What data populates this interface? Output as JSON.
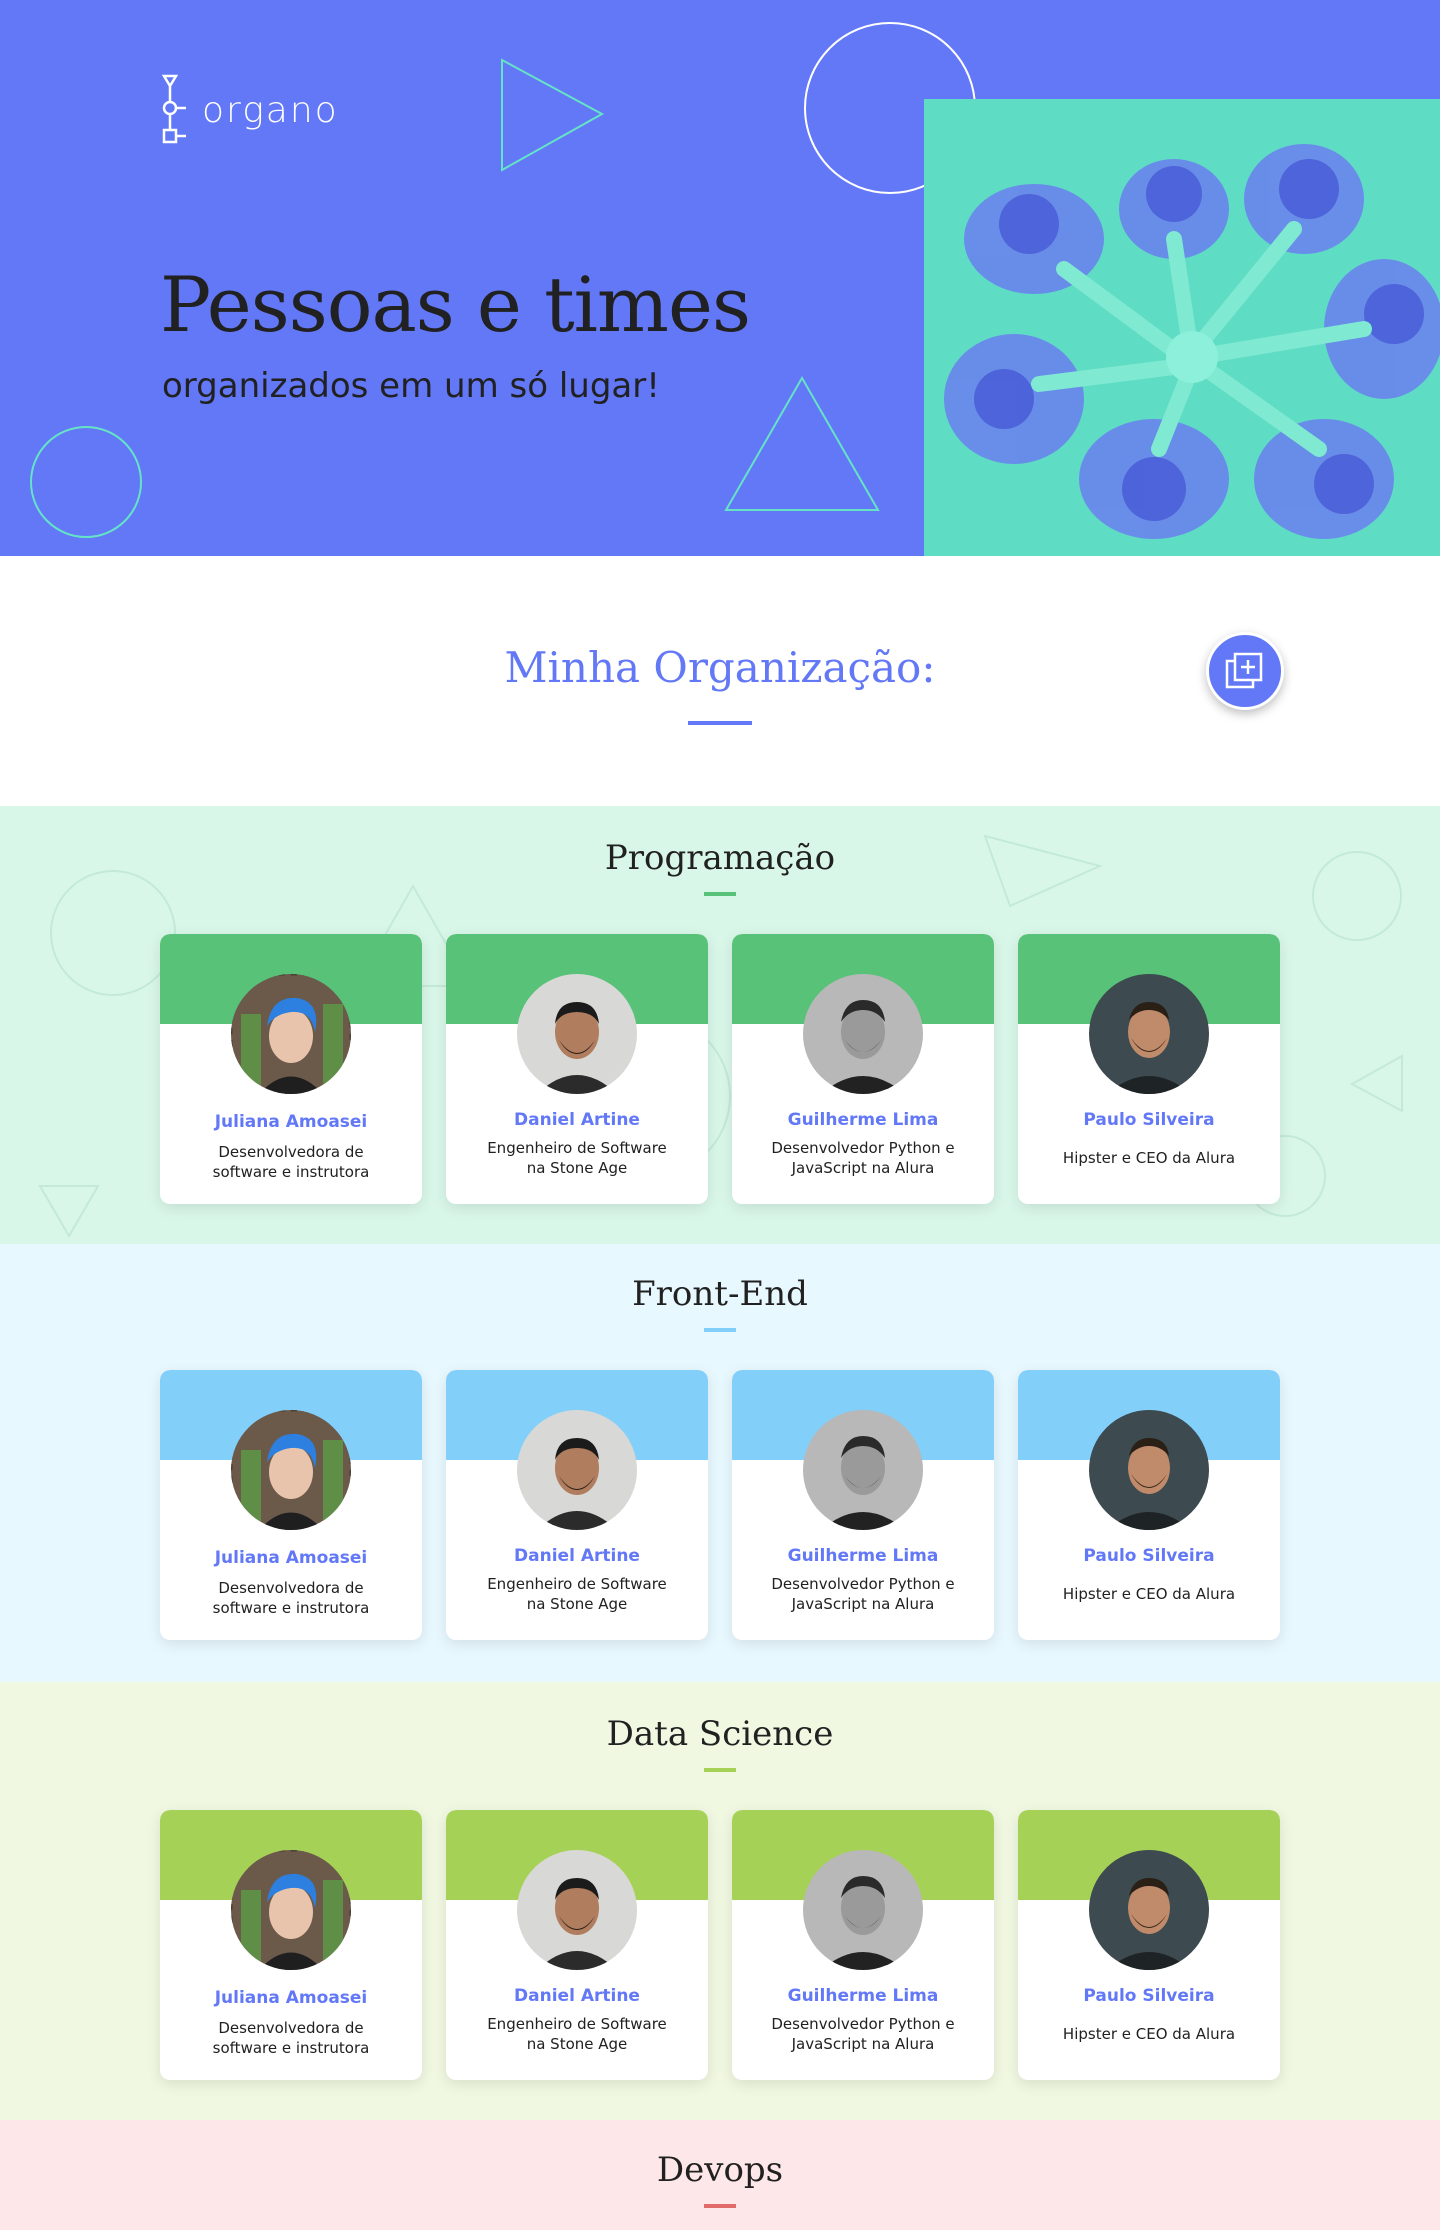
{
  "brand": {
    "name": "organo"
  },
  "hero": {
    "title": "Pessoas e times",
    "subtitle": "organizados em um só lugar!",
    "photo_icon": "team-photo"
  },
  "org": {
    "title": "Minha Organização:",
    "add_button_icon": "add-collaborator-icon"
  },
  "colors": {
    "primary": "#6278f7",
    "programacao": {
      "primary": "#57c278",
      "secondary": "#d9f7e9"
    },
    "frontend": {
      "primary": "#82cffa",
      "secondary": "#e8f8ff"
    },
    "datascience": {
      "primary": "#a6d157",
      "secondary": "#f0f8e2"
    },
    "devops": {
      "primary": "#e06b69",
      "secondary": "#fde7e8"
    }
  },
  "teams": [
    {
      "name": "Programação",
      "members": [
        {
          "name": "Juliana Amoasei",
          "role_l1": "Desenvolvedora de",
          "role_l2": "software e instrutora"
        },
        {
          "name": "Daniel Artine",
          "role_l1": "Engenheiro de Software",
          "role_l2": "na Stone Age"
        },
        {
          "name": "Guilherme Lima",
          "role_l1": "Desenvolvedor Python e",
          "role_l2": "JavaScript na Alura"
        },
        {
          "name": "Paulo Silveira",
          "role_l1": "Hipster e CEO da Alura",
          "role_l2": ""
        }
      ]
    },
    {
      "name": "Front-End",
      "members": [
        {
          "name": "Juliana Amoasei",
          "role_l1": "Desenvolvedora de",
          "role_l2": "software e instrutora"
        },
        {
          "name": "Daniel Artine",
          "role_l1": "Engenheiro de Software",
          "role_l2": "na Stone Age"
        },
        {
          "name": "Guilherme Lima",
          "role_l1": "Desenvolvedor Python e",
          "role_l2": "JavaScript na Alura"
        },
        {
          "name": "Paulo Silveira",
          "role_l1": "Hipster e CEO da Alura",
          "role_l2": ""
        }
      ]
    },
    {
      "name": "Data Science",
      "members": [
        {
          "name": "Juliana Amoasei",
          "role_l1": "Desenvolvedora de",
          "role_l2": "software e instrutora"
        },
        {
          "name": "Daniel Artine",
          "role_l1": "Engenheiro de Software",
          "role_l2": "na Stone Age"
        },
        {
          "name": "Guilherme Lima",
          "role_l1": "Desenvolvedor Python e",
          "role_l2": "JavaScript na Alura"
        },
        {
          "name": "Paulo Silveira",
          "role_l1": "Hipster e CEO da Alura",
          "role_l2": ""
        }
      ]
    },
    {
      "name": "Devops",
      "members": []
    }
  ]
}
